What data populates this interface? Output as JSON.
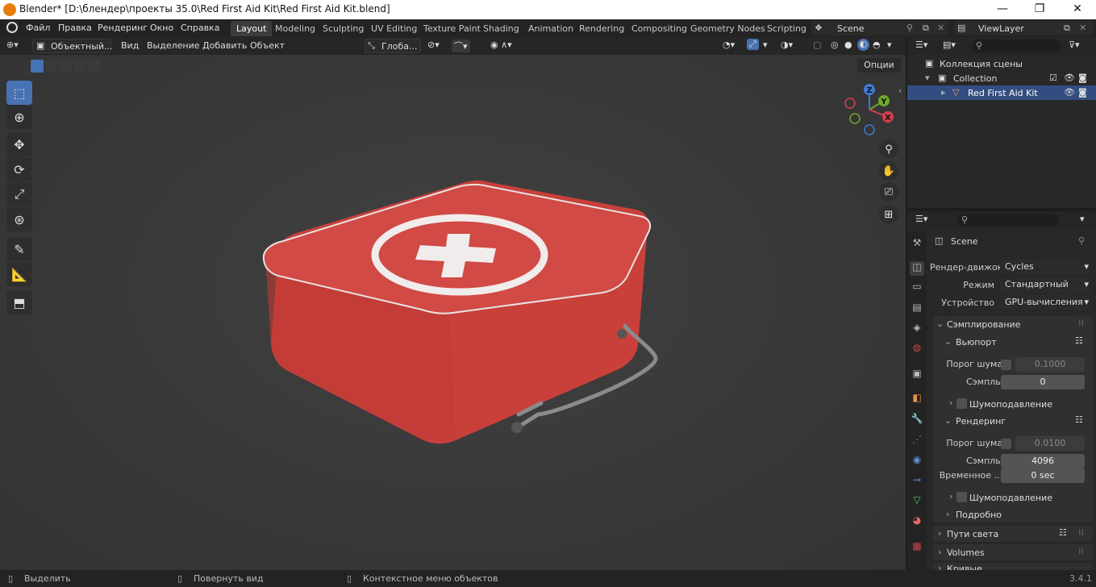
{
  "window": {
    "title": "Blender* [D:\\блендер\\проекты 35.0\\Red First Aid Kit\\Red First Aid Kit.blend]",
    "minimize": "—",
    "maximize": "❐",
    "close": "✕"
  },
  "menu": [
    "Файл",
    "Правка",
    "Рендеринг",
    "Окно",
    "Справка"
  ],
  "workspaces": [
    "Layout",
    "Modeling",
    "Sculpting",
    "UV Editing",
    "Texture Paint",
    "Shading",
    "Animation",
    "Rendering",
    "Compositing",
    "Geometry Nodes",
    "Scripting"
  ],
  "active_workspace": "Layout",
  "scene_name": "Scene",
  "view_layer": "ViewLayer",
  "viewport_header": {
    "mode": "Объектный...",
    "menus": [
      "Вид",
      "Выделение",
      "Добавить",
      "Объект"
    ],
    "orientation": "Глоба...",
    "options": "Опции"
  },
  "gizmo": {
    "z": "Z",
    "y": "Y",
    "x": "X"
  },
  "outliner": {
    "scene_collection": "Коллекция сцены",
    "collection": "Collection",
    "object": "Red First Aid Kit"
  },
  "properties": {
    "scene_label": "Scene",
    "render_engine_label": "Рендер-движок",
    "render_engine": "Cycles",
    "mode_label": "Режим",
    "mode": "Стандартный",
    "device_label": "Устройство",
    "device": "GPU-вычисления",
    "sampling": "Сэмплирование",
    "viewport": "Вьюпорт",
    "noise_threshold_label": "Порог шума",
    "viewport_noise_threshold": "0.1000",
    "samples_label": "Сэмплы",
    "viewport_samples": "0",
    "denoise": "Шумоподавление",
    "render": "Рендеринг",
    "render_noise_threshold": "0.0100",
    "render_samples": "4096",
    "time_limit_label": "Временное ...",
    "time_limit": "0 sec",
    "render_denoise": "Шумоподавление",
    "advanced": "Подробно",
    "light_paths": "Пути света",
    "volumes": "Volumes",
    "curves": "Кривые"
  },
  "statusbar": {
    "select": "Выделить",
    "rotate": "Повернуть вид",
    "context": "Контекстное меню объектов",
    "version": "3.4.1"
  },
  "colors": {
    "accent": "#4772b3",
    "kit_red": "#d9534f",
    "title_bg": "#ffffff",
    "header_bg": "#232323",
    "panel_bg": "#303030"
  }
}
